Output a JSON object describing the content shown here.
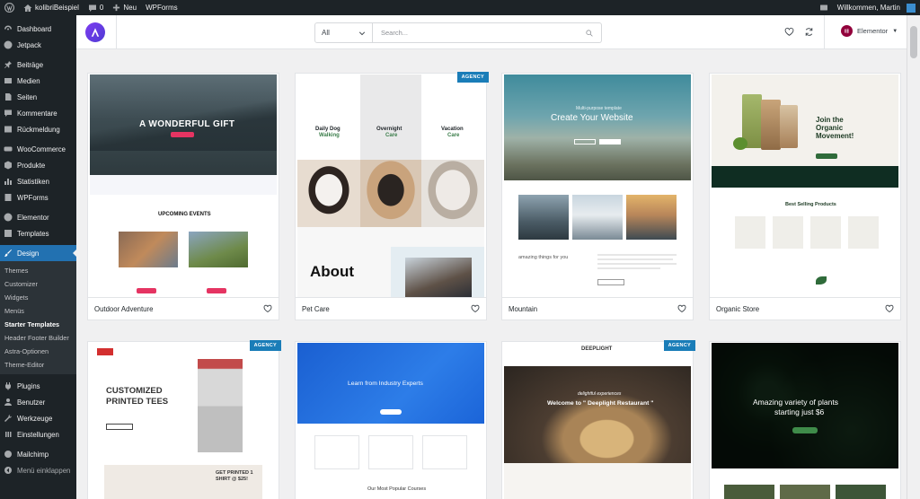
{
  "adminbar": {
    "site_name": "kolibriBeispiel",
    "comments_count": "0",
    "new_label": "Neu",
    "wpforms_label": "WPForms",
    "welcome": "Willkommen, Martin"
  },
  "sidebar": {
    "items": [
      {
        "label": "Dashboard",
        "icon": "dashboard-icon"
      },
      {
        "label": "Jetpack",
        "icon": "jetpack-icon"
      },
      {
        "label": "Beiträge",
        "icon": "pin-icon"
      },
      {
        "label": "Medien",
        "icon": "media-icon"
      },
      {
        "label": "Seiten",
        "icon": "pages-icon"
      },
      {
        "label": "Kommentare",
        "icon": "comments-icon"
      },
      {
        "label": "Rückmeldung",
        "icon": "feedback-icon"
      },
      {
        "label": "WooCommerce",
        "icon": "woocommerce-icon"
      },
      {
        "label": "Produkte",
        "icon": "products-icon"
      },
      {
        "label": "Statistiken",
        "icon": "stats-icon"
      },
      {
        "label": "WPForms",
        "icon": "wpforms-icon"
      },
      {
        "label": "Elementor",
        "icon": "elementor-icon"
      },
      {
        "label": "Templates",
        "icon": "templates-icon"
      },
      {
        "label": "Design",
        "icon": "brush-icon"
      }
    ],
    "submenu": [
      "Themes",
      "Customizer",
      "Widgets",
      "Menüs",
      "Starter Templates",
      "Header Footer Builder",
      "Astra-Optionen",
      "Theme-Editor"
    ],
    "items_after": [
      {
        "label": "Plugins",
        "icon": "plugins-icon"
      },
      {
        "label": "Benutzer",
        "icon": "users-icon"
      },
      {
        "label": "Werkzeuge",
        "icon": "tools-icon"
      },
      {
        "label": "Einstellungen",
        "icon": "settings-icon"
      },
      {
        "label": "Mailchimp",
        "icon": "mailchimp-icon"
      },
      {
        "label": "Menü einklappen",
        "icon": "collapse-icon"
      }
    ]
  },
  "toolbar": {
    "filter_value": "All",
    "search_placeholder": "Search...",
    "page_builder": "Elementor"
  },
  "templates": [
    {
      "name": "Outdoor Adventure",
      "badge": "",
      "texts": {
        "hero": "A WONDERFUL GIFT",
        "section": "UPCOMING EVENTS"
      }
    },
    {
      "name": "Pet Care",
      "badge": "AGENCY",
      "texts": {
        "c1a": "Daily Dog",
        "c1b": "Walking",
        "c2a": "Overnight",
        "c2b": "Care",
        "c3a": "Vacation",
        "c3b": "Care",
        "about": "About"
      }
    },
    {
      "name": "Mountain",
      "badge": "",
      "texts": {
        "sub": "Multi-purpose template",
        "hero": "Create Your Website",
        "tagline": "amazing things for you"
      }
    },
    {
      "name": "Organic Store",
      "badge": "",
      "texts": {
        "hero": "Join the Organic Movement!",
        "section": "Best Selling Products"
      }
    },
    {
      "name": "",
      "badge": "AGENCY",
      "texts": {
        "hero1": "CUSTOMIZED",
        "hero2": "PRINTED TEES",
        "promo": "GET PRINTED 1 SHIRT @ $25!"
      }
    },
    {
      "name": "",
      "badge": "",
      "texts": {
        "hero": "Learn from Industry Experts",
        "section": "Our Most Popular Courses"
      }
    },
    {
      "name": "",
      "badge": "AGENCY",
      "texts": {
        "logo": "DEEPLIGHT",
        "script": "delightful experiences",
        "hero": "Welcome to \" Deeplight Restaurant \""
      }
    },
    {
      "name": "",
      "badge": "",
      "texts": {
        "hero1": "Amazing variety of plants",
        "hero2": "starting just $6"
      }
    }
  ],
  "colors": {
    "wp_blue": "#2271b1",
    "adminbar": "#1d2327",
    "astra_purple": "#6f3df0",
    "agency_badge": "#1a7db8"
  }
}
